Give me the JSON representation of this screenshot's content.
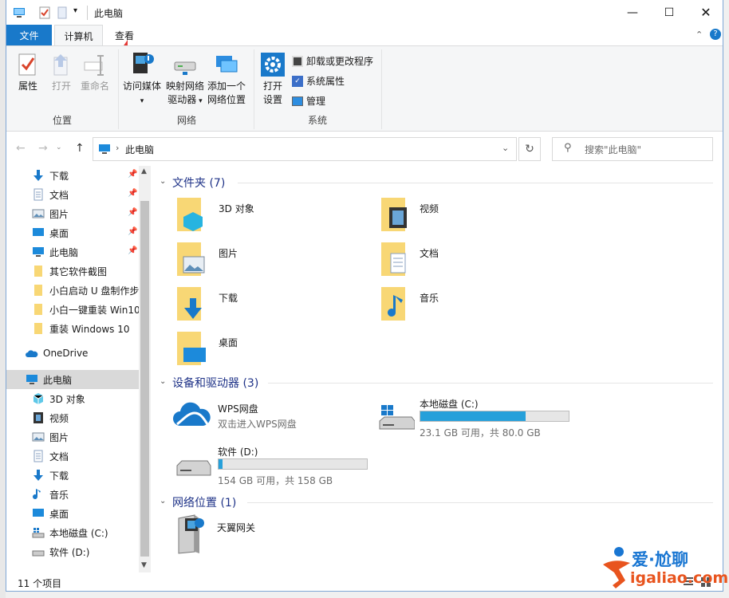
{
  "window": {
    "title": "此电脑"
  },
  "tabs": {
    "file": "文件",
    "computer": "计算机",
    "view": "查看"
  },
  "ribbon": {
    "properties": "属性",
    "open": "打开",
    "rename": "重命名",
    "access_media": "访问媒体",
    "map_drive_1": "映射网络",
    "map_drive_2": "驱动器",
    "add_loc_1": "添加一个",
    "add_loc_2": "网络位置",
    "open_settings_1": "打开",
    "open_settings_2": "设置",
    "uninstall": "卸载或更改程序",
    "sys_props": "系统属性",
    "manage": "管理",
    "group_location": "位置",
    "group_network": "网络",
    "group_system": "系统"
  },
  "address": {
    "path": "此电脑",
    "search_placeholder": "搜索\"此电脑\""
  },
  "nav": {
    "items": [
      {
        "label": "下载",
        "pinned": true
      },
      {
        "label": "文档",
        "pinned": true
      },
      {
        "label": "图片",
        "pinned": true
      },
      {
        "label": "桌面",
        "pinned": true
      },
      {
        "label": "此电脑",
        "pinned": true
      },
      {
        "label": "其它软件截图"
      },
      {
        "label": "小白启动 U 盘制作步"
      },
      {
        "label": "小白一键重装 Win10"
      },
      {
        "label": "重装 Windows 10"
      },
      {
        "label": "OneDrive"
      },
      {
        "label": "此电脑"
      },
      {
        "label": "3D 对象"
      },
      {
        "label": "视频"
      },
      {
        "label": "图片"
      },
      {
        "label": "文档"
      },
      {
        "label": "下载"
      },
      {
        "label": "音乐"
      },
      {
        "label": "桌面"
      },
      {
        "label": "本地磁盘 (C:)"
      },
      {
        "label": "软件 (D:)"
      }
    ]
  },
  "folders": {
    "header": "文件夹 (7)",
    "items": [
      {
        "label": "3D 对象"
      },
      {
        "label": "视频"
      },
      {
        "label": "图片"
      },
      {
        "label": "文档"
      },
      {
        "label": "下载"
      },
      {
        "label": "音乐"
      },
      {
        "label": "桌面"
      }
    ]
  },
  "devices": {
    "header": "设备和驱动器 (3)",
    "wps": {
      "label": "WPS网盘",
      "sub": "双击进入WPS网盘"
    },
    "c_drive": {
      "label": "本地磁盘 (C:)",
      "sub": "23.1 GB 可用，共 80.0 GB",
      "used_fraction": 0.71
    },
    "d_drive": {
      "label": "软件 (D:)",
      "sub": "154 GB 可用，共 158 GB",
      "used_fraction": 0.025
    }
  },
  "network": {
    "header": "网络位置 (1)",
    "item": "天翼网关"
  },
  "status": {
    "count": "11 个项目"
  },
  "watermark": {
    "brand": "爱·尬聊",
    "url": "igaliao.com"
  },
  "colors": {
    "accent": "#1979ca",
    "fill": "#26a0da",
    "folder": "#f8d775"
  }
}
